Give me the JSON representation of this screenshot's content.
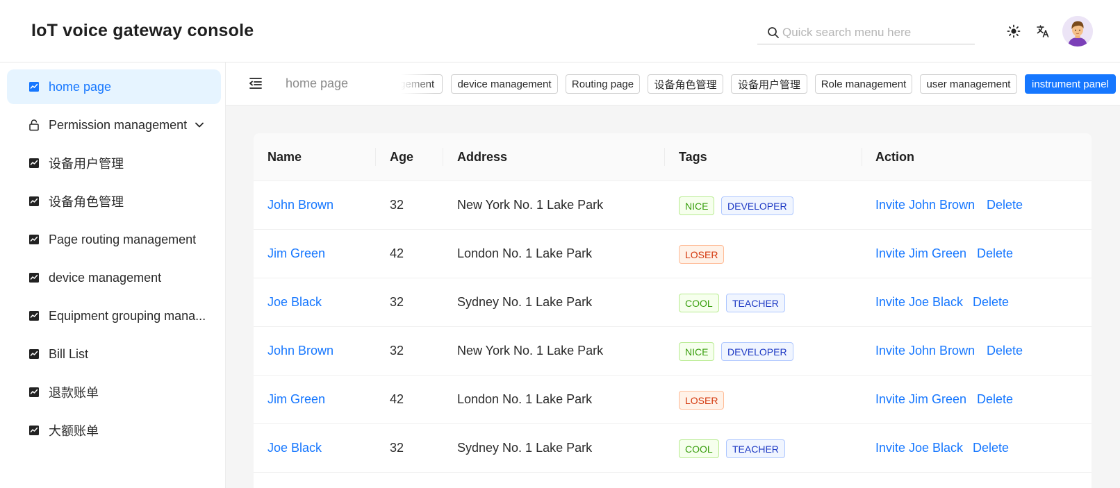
{
  "header": {
    "title": "IoT voice gateway console",
    "search_placeholder": "Quick search menu here",
    "theme_icon": "sun-icon",
    "language_icon": "translate-icon",
    "avatar_icon": "user-avatar"
  },
  "sidebar": {
    "items": [
      {
        "label": "home page",
        "icon": "chart-icon",
        "active": true
      },
      {
        "label": "Permission management",
        "icon": "lock-icon",
        "expandable": true
      },
      {
        "label": "设备用户管理",
        "icon": "chart-icon"
      },
      {
        "label": "设备角色管理",
        "icon": "chart-icon"
      },
      {
        "label": "Page routing management",
        "icon": "chart-icon"
      },
      {
        "label": "device management",
        "icon": "chart-icon"
      },
      {
        "label": "Equipment grouping mana...",
        "icon": "chart-icon"
      },
      {
        "label": "Bill List",
        "icon": "chart-icon"
      },
      {
        "label": "退款账单",
        "icon": "chart-icon"
      },
      {
        "label": "大额账单",
        "icon": "chart-icon"
      }
    ]
  },
  "tabbar": {
    "breadcrumb": "home page",
    "tags": [
      {
        "label": "agement",
        "active": false
      },
      {
        "label": "device management",
        "active": false
      },
      {
        "label": "Routing page",
        "active": false
      },
      {
        "label": "设备角色管理",
        "active": false
      },
      {
        "label": "设备用户管理",
        "active": false
      },
      {
        "label": "Role management",
        "active": false
      },
      {
        "label": "user management",
        "active": false
      },
      {
        "label": "instrument panel",
        "active": true
      }
    ]
  },
  "table": {
    "columns": [
      "Name",
      "Age",
      "Address",
      "Tags",
      "Action"
    ],
    "rows": [
      {
        "name": "John Brown",
        "age": "32",
        "address": "New York No. 1 Lake Park",
        "tags": [
          "NICE",
          "DEVELOPER"
        ],
        "invite": "Invite John Brown",
        "delete": "Delete"
      },
      {
        "name": "Jim Green",
        "age": "42",
        "address": "London No. 1 Lake Park",
        "tags": [
          "LOSER"
        ],
        "invite": "Invite Jim Green",
        "delete": "Delete"
      },
      {
        "name": "Joe Black",
        "age": "32",
        "address": "Sydney No. 1 Lake Park",
        "tags": [
          "COOL",
          "TEACHER"
        ],
        "invite": "Invite Joe Black",
        "delete": "Delete"
      },
      {
        "name": "John Brown",
        "age": "32",
        "address": "New York No. 1 Lake Park",
        "tags": [
          "NICE",
          "DEVELOPER"
        ],
        "invite": "Invite John Brown",
        "delete": "Delete"
      },
      {
        "name": "Jim Green",
        "age": "42",
        "address": "London No. 1 Lake Park",
        "tags": [
          "LOSER"
        ],
        "invite": "Invite Jim Green",
        "delete": "Delete"
      },
      {
        "name": "Joe Black",
        "age": "32",
        "address": "Sydney No. 1 Lake Park",
        "tags": [
          "COOL",
          "TEACHER"
        ],
        "invite": "Invite Joe Black",
        "delete": "Delete"
      }
    ]
  },
  "colors": {
    "accent": "#1677ff",
    "active_bg": "#e6f4ff",
    "tag_green": "#389e0d",
    "tag_geekblue": "#1d39c4",
    "tag_volcano": "#d4380d"
  }
}
